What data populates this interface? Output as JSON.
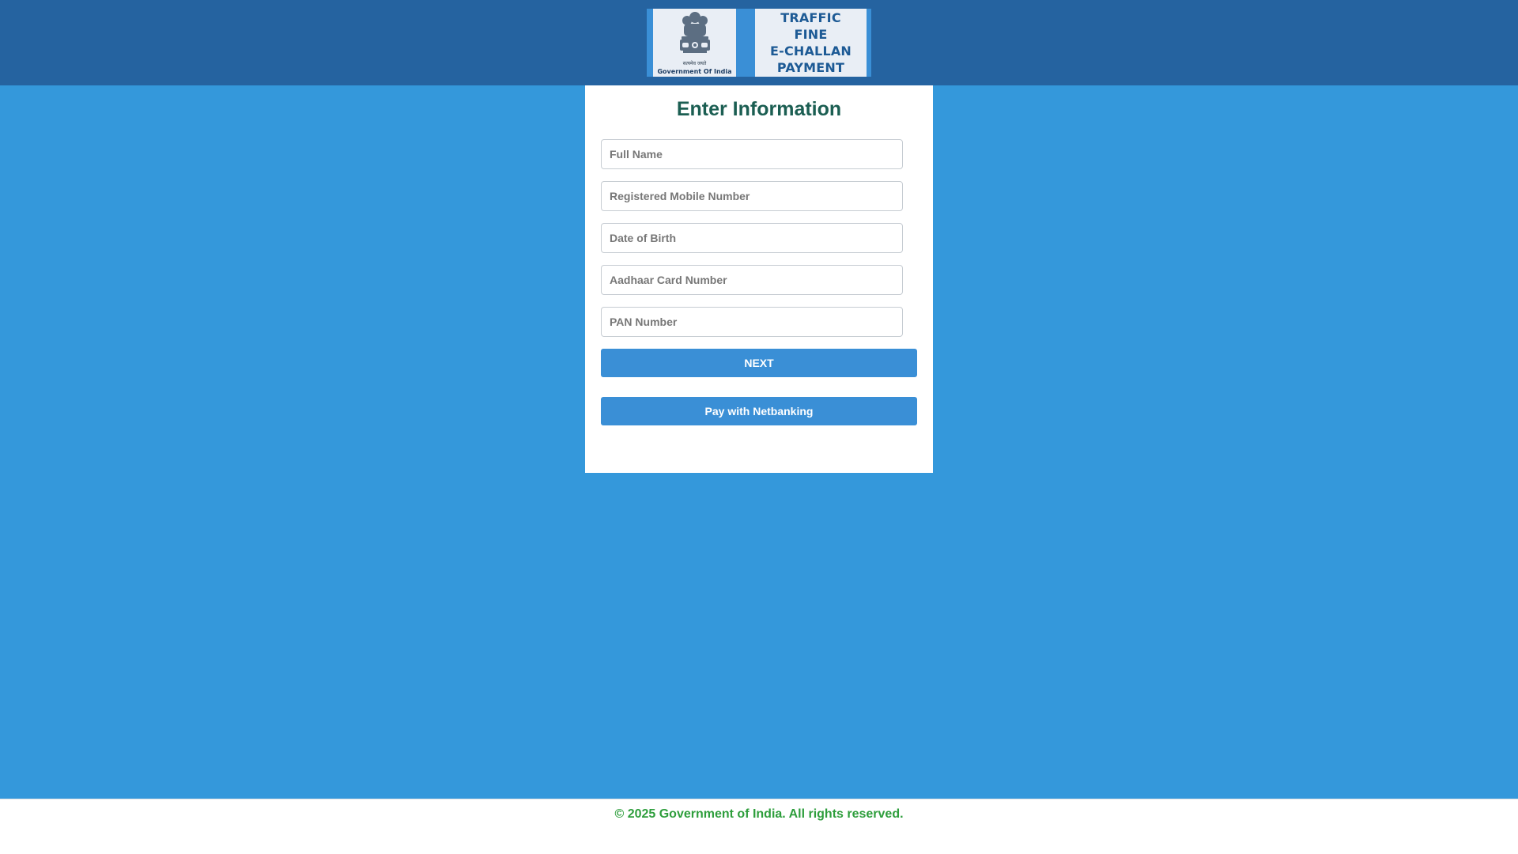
{
  "header": {
    "banner": {
      "emblem_caption_hindi": "सत्यमेव जयते",
      "emblem_caption": "Government Of India",
      "title_lines": [
        "TRAFFIC",
        "FINE",
        "E-CHALLAN",
        "PAYMENT"
      ]
    }
  },
  "form": {
    "title": "Enter Information",
    "fields": {
      "full_name": {
        "placeholder": "Full Name",
        "value": ""
      },
      "mobile": {
        "placeholder": "Registered Mobile Number",
        "value": ""
      },
      "dob": {
        "placeholder": "Date of Birth",
        "value": ""
      },
      "aadhaar": {
        "placeholder": "Aadhaar Card Number",
        "value": ""
      },
      "pan": {
        "placeholder": "PAN Number",
        "value": ""
      }
    },
    "next_label": "NEXT",
    "netbanking_label": "Pay with Netbanking"
  },
  "footer": {
    "text": "© 2025 Government of India. All rights reserved."
  },
  "colors": {
    "page_background": "#3498db",
    "header_background": "#2563a0",
    "button": "#3a8fd6",
    "title": "#1b5e52",
    "footer_text": "#2e9e3c"
  },
  "icons": [
    "ashoka-emblem-icon"
  ]
}
